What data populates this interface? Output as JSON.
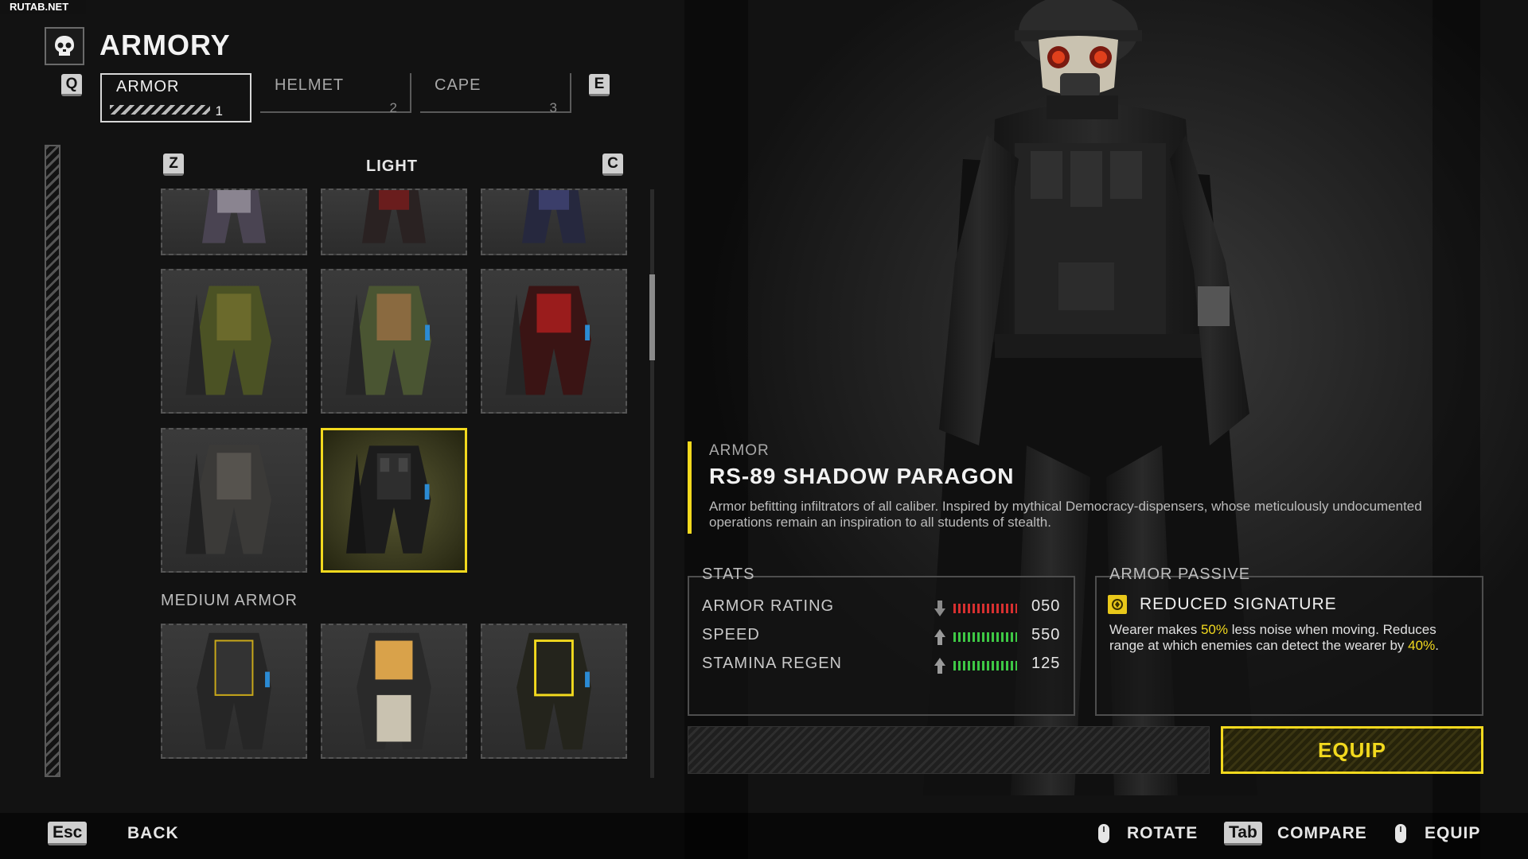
{
  "watermark": "RUTAB.NET",
  "header": {
    "title": "ARMORY",
    "key_prev": "Q",
    "key_next": "E"
  },
  "tabs": [
    {
      "label": "ARMOR",
      "num": "1"
    },
    {
      "label": "HELMET",
      "num": "2"
    },
    {
      "label": "CAPE",
      "num": "3"
    }
  ],
  "category": {
    "key_prev": "Z",
    "key_next": "C",
    "title": "LIGHT"
  },
  "section_medium": "MEDIUM ARMOR",
  "item": {
    "type": "ARMOR",
    "name": "RS-89 SHADOW PARAGON",
    "description": "Armor befitting infiltrators of all caliber. Inspired by mythical Democracy-dispensers, whose meticulously undocumented operations remain an inspiration to all students of stealth."
  },
  "stats": {
    "title": "STATS",
    "rows": [
      {
        "label": "ARMOR RATING",
        "value": "050",
        "trend": "down",
        "color": "#d63030"
      },
      {
        "label": "SPEED",
        "value": "550",
        "trend": "up",
        "color": "#3ec845"
      },
      {
        "label": "STAMINA REGEN",
        "value": "125",
        "trend": "up",
        "color": "#3ec845"
      }
    ]
  },
  "passive": {
    "title": "ARMOR PASSIVE",
    "name": "REDUCED SIGNATURE",
    "desc_1": "Wearer makes ",
    "hl_1": "50%",
    "desc_2": " less noise when moving. Reduces range at which enemies can detect the wearer by ",
    "hl_2": "40%",
    "desc_3": "."
  },
  "equip_label": "EQUIP",
  "footer": {
    "back_key": "Esc",
    "back_label": "BACK",
    "rotate_label": "ROTATE",
    "compare_key": "Tab",
    "compare_label": "COMPARE",
    "equip_label": "EQUIP"
  },
  "colors": {
    "accent": "#f2d91e",
    "stat_up": "#3ec845",
    "stat_down": "#d63030"
  }
}
